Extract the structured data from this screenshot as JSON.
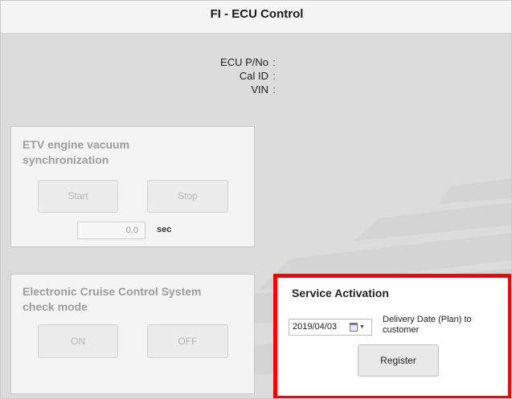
{
  "window": {
    "title": "FI - ECU Control"
  },
  "ecu_info": {
    "rows": [
      {
        "label": "ECU P/No",
        "colon": ":",
        "value": ""
      },
      {
        "label": "Cal ID",
        "colon": ":",
        "value": ""
      },
      {
        "label": "VIN",
        "colon": ":",
        "value": ""
      }
    ]
  },
  "etv_panel": {
    "title_line1": "ETV engine vacuum",
    "title_line2": "synchronization",
    "start_label": "Start",
    "stop_label": "Stop",
    "seconds_value": "0.0",
    "seconds_unit": "sec"
  },
  "cruise_panel": {
    "title_line1": "Electronic Cruise Control System",
    "title_line2": "check mode",
    "on_label": "ON",
    "off_label": "OFF"
  },
  "service_activation": {
    "title": "Service Activation",
    "date_value": "2019/04/03",
    "date_caption_line1": "Delivery Date (Plan) to",
    "date_caption_line2": "customer",
    "register_label": "Register"
  },
  "colors": {
    "highlight": "#ff0000",
    "background": "#dcdcdc",
    "panel": "#f4f4f4",
    "disabled_text": "#9c9c9c"
  },
  "icons": {
    "date_picker": "calendar-icon",
    "dropdown": "chevron-down-icon"
  }
}
